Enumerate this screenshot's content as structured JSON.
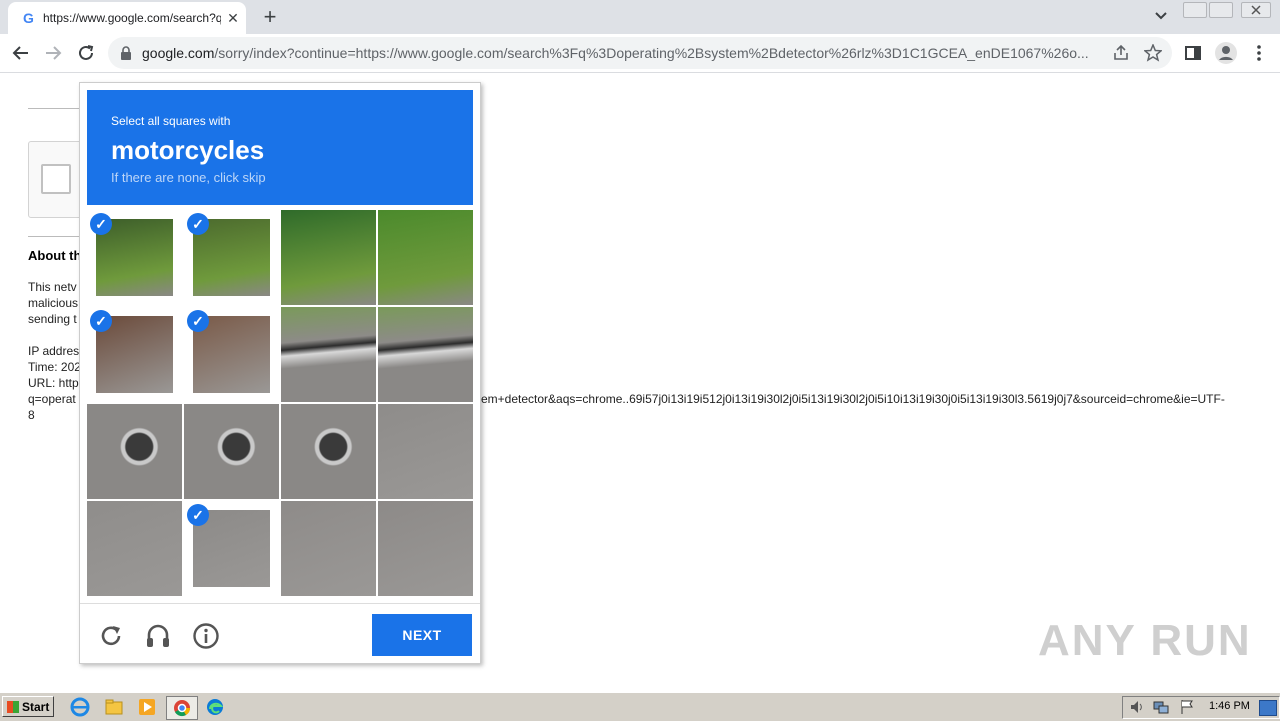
{
  "browser": {
    "tab_title": "https://www.google.com/search?q=",
    "url_host": "google.com",
    "url_rest": "/sorry/index?continue=https://www.google.com/search%3Fq%3Doperating%2Bsystem%2Bdetector%26rlz%3D1C1GCEA_enDE1067%26o..."
  },
  "page": {
    "about_heading": "About th",
    "body_lines": [
      "This netv",
      "malicious",
      "sending t"
    ],
    "ip_label": "IP addres",
    "time_label": "Time: 202",
    "url_label": "URL: http",
    "url_line_start": "q=operat",
    "url_line_end": "8",
    "url_tail": "em+detector&aqs=chrome..69i57j0i13i19i512j0i13i19i30l2j0i5i13i19i30l2j0i5i10i13i19i30j0i5i13i19i30l3.5619j0j7&sourceid=chrome&ie=UTF-"
  },
  "challenge": {
    "instruction": "Select all squares with",
    "target": "motorcycles",
    "hint": "If there are none, click skip",
    "next_label": "NEXT",
    "selected_tiles": [
      0,
      1,
      4,
      5,
      13
    ]
  },
  "watermark": "ANY RUN",
  "taskbar": {
    "start_label": "Start",
    "clock": "1:46 PM"
  },
  "colors": {
    "accent": "#1a73e8"
  }
}
